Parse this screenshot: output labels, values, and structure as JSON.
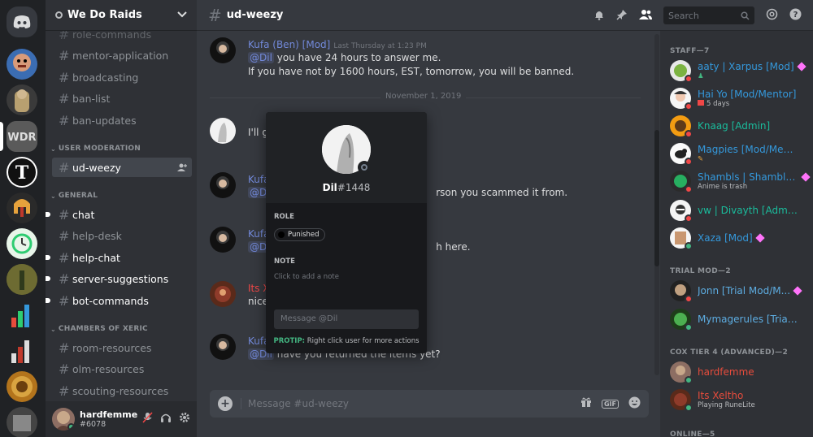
{
  "server": {
    "name": "We Do Raids"
  },
  "channels": {
    "items": [
      {
        "name": "role-commands"
      },
      {
        "name": "mentor-application"
      },
      {
        "name": "broadcasting"
      },
      {
        "name": "ban-list"
      },
      {
        "name": "ban-updates"
      }
    ],
    "categories": [
      {
        "label": "USER MODERATION",
        "items": [
          {
            "name": "ud-weezy",
            "state": "active"
          }
        ]
      },
      {
        "label": "GENERAL",
        "items": [
          {
            "name": "chat",
            "state": "unread"
          },
          {
            "name": "help-desk",
            "state": "read"
          },
          {
            "name": "help-chat",
            "state": "unread"
          },
          {
            "name": "server-suggestions",
            "state": "unread"
          },
          {
            "name": "bot-commands",
            "state": "unread"
          }
        ]
      },
      {
        "label": "CHAMBERS OF XERIC",
        "items": [
          {
            "name": "room-resources"
          },
          {
            "name": "olm-resources"
          },
          {
            "name": "scouting-resources"
          }
        ]
      }
    ]
  },
  "user": {
    "name": "hardfemme",
    "tag": "#6078"
  },
  "chat": {
    "channel": "ud-weezy",
    "search_placeholder": "Search",
    "date_divider": "November 1, 2019",
    "composer_placeholder": "Message #ud-weezy",
    "messages": [
      {
        "author": "Kufa (Ben) [Mod]",
        "timestamp": "Last Thursday at 1:23 PM",
        "mention": "@Dil",
        "text": "you have 24 hours to answer me.",
        "line2": "If you have not by 1600 hours, EST, tomorrow, you will be banned."
      },
      {
        "author": "",
        "partial": "I'll g"
      },
      {
        "author": "Kufa",
        "mention": "@D",
        "text": "rson you scammed it from."
      },
      {
        "author": "Kufa",
        "mention": "@D",
        "text": "h here."
      },
      {
        "author": "Its X",
        "partial": "nice"
      },
      {
        "author": "Kufa",
        "mention": "@Dil",
        "text": "have you returned the items yet?"
      }
    ]
  },
  "popout": {
    "username": "Dil",
    "discriminator": "#1448",
    "role_heading": "ROLE",
    "role": "Punished",
    "note_heading": "NOTE",
    "note_placeholder": "Click to add a note",
    "message_placeholder": "Message @Dil",
    "protip_label": "PROTIP:",
    "protip_text": "Right click user for more actions"
  },
  "members": {
    "groups": [
      {
        "label": "STAFF—7"
      },
      {
        "label": "TRIAL MOD—2"
      },
      {
        "label": "COX TIER 4 (ADVANCED)—2"
      },
      {
        "label": "ONLINE—5"
      }
    ],
    "list": [
      {
        "name": "aaty | Xarpus [Mod]",
        "color": "#3498db",
        "status_color": "#f04747"
      },
      {
        "name": "Hai Yo [Mod/Mentor]",
        "sub": "5 days",
        "color": "#3498db",
        "status_color": "#f04747"
      },
      {
        "name": "Knaag [Admin]",
        "color": "#1abc9c",
        "status_color": "#f04747"
      },
      {
        "name": "Magpies [Mod/Ment...",
        "color": "#3498db",
        "status_color": "#f04747"
      },
      {
        "name": "Shambls | Shamblet ...",
        "sub": "Anime is trash",
        "color": "#3498db",
        "status_color": "#f04747"
      },
      {
        "name": "vw | Divayth [Admin]",
        "color": "#1abc9c",
        "status_color": "#f04747"
      },
      {
        "name": "Xaza [Mod]",
        "color": "#3498db",
        "status_color": "#43b581"
      },
      {
        "name": "Jonn [Trial Mod/M...",
        "color": "#5dade2",
        "status_color": "#f04747"
      },
      {
        "name": "Mymagerules [Trial M...",
        "color": "#5dade2",
        "status_color": "#43b581"
      },
      {
        "name": "hardfemme",
        "color": "#e74c3c",
        "status_color": "#43b581"
      },
      {
        "name": "Its Xeltho",
        "sub": "Playing RuneLite",
        "color": "#e74c3c",
        "status_color": "#43b581"
      }
    ]
  },
  "colors": {
    "blurple": "#7289da",
    "online": "#43b581",
    "dnd": "#f04747",
    "nitro": "#ff73fa"
  }
}
